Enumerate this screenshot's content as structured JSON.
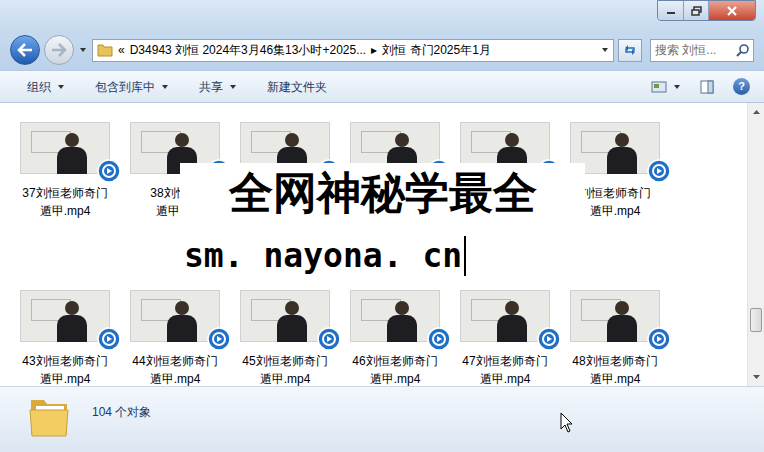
{
  "address": {
    "overflow": "«",
    "segments": [
      "D34943 刘恒 2024年3月46集13小时+2025...",
      "刘恒 奇门2025年1月"
    ],
    "separator": "▸"
  },
  "search": {
    "placeholder": "搜索 刘恒..."
  },
  "toolbar": {
    "buttons": [
      {
        "label": "组织",
        "dropdown": true
      },
      {
        "label": "包含到库中",
        "dropdown": true
      },
      {
        "label": "共享",
        "dropdown": true
      },
      {
        "label": "新建文件夹",
        "dropdown": false
      }
    ],
    "help": "?"
  },
  "files": [
    {
      "lines": [
        "37刘恒老师奇门",
        "遁甲.mp4"
      ]
    },
    {
      "lines": [
        "38刘恒老",
        "遁甲.m"
      ]
    },
    {
      "lines": []
    },
    {
      "lines": []
    },
    {
      "lines": []
    },
    {
      "lines": [
        "刘恒老师奇门",
        "遁甲.mp4"
      ]
    },
    {
      "lines": [
        "43刘恒老师奇门",
        "遁甲.mp4"
      ]
    },
    {
      "lines": [
        "44刘恒老师奇门",
        "遁甲.mp4"
      ]
    },
    {
      "lines": [
        "45刘恒老师奇门",
        "遁甲.mp4"
      ]
    },
    {
      "lines": [
        "46刘恒老师奇门",
        "遁甲.mp4"
      ]
    },
    {
      "lines": [
        "47刘恒老师奇门",
        "遁甲.mp4"
      ]
    },
    {
      "lines": [
        "48刘恒老师奇门",
        "遁甲.mp4"
      ]
    }
  ],
  "watermark": [
    "全网神秘学最全",
    "sm. nayona. cn"
  ],
  "status_bar": {
    "count": "104 个对象"
  },
  "scrollbar": {
    "level": 0.85
  }
}
